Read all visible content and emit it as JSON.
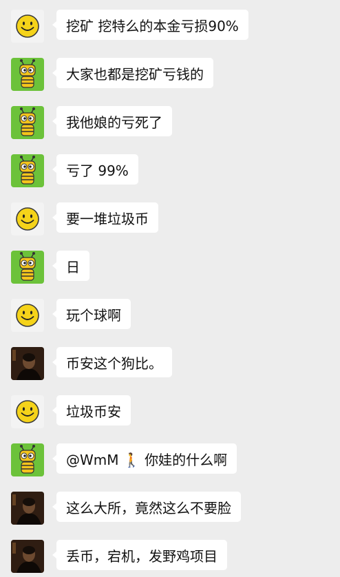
{
  "chat": {
    "messages": [
      {
        "avatar": "smiley-avatar-icon",
        "text": "挖矿 挖特么的本金亏损90%"
      },
      {
        "avatar": "bee-avatar-icon",
        "text": "大家也都是挖矿亏钱的"
      },
      {
        "avatar": "bee-avatar-icon",
        "text": "我他娘的亏死了"
      },
      {
        "avatar": "bee-avatar-icon",
        "text": "亏了 99%"
      },
      {
        "avatar": "smiley-avatar-icon",
        "text": "要一堆垃圾币"
      },
      {
        "avatar": "bee-avatar-icon",
        "text": "日"
      },
      {
        "avatar": "smiley-avatar-icon",
        "text": "玩个球啊"
      },
      {
        "avatar": "photo-avatar-icon",
        "text": "币安这个狗比。"
      },
      {
        "avatar": "smiley-avatar-icon",
        "text": "垃圾币安"
      },
      {
        "avatar": "bee-avatar-icon",
        "text": "@WmM 🚶 你娃的什么啊"
      },
      {
        "avatar": "photo-avatar-icon",
        "text": "这么大所，竟然这么不要脸"
      },
      {
        "avatar": "photo-avatar-icon",
        "text": "丢币，宕机，发野鸡项目"
      }
    ]
  },
  "colors": {
    "background": "#ededed",
    "bubble": "#ffffff",
    "text": "#111111",
    "smiley_bg": "#f3f3f3",
    "smiley_face": "#f5d31a",
    "bee_bg": "#6cc23a",
    "bee_body": "#f4c51c"
  }
}
